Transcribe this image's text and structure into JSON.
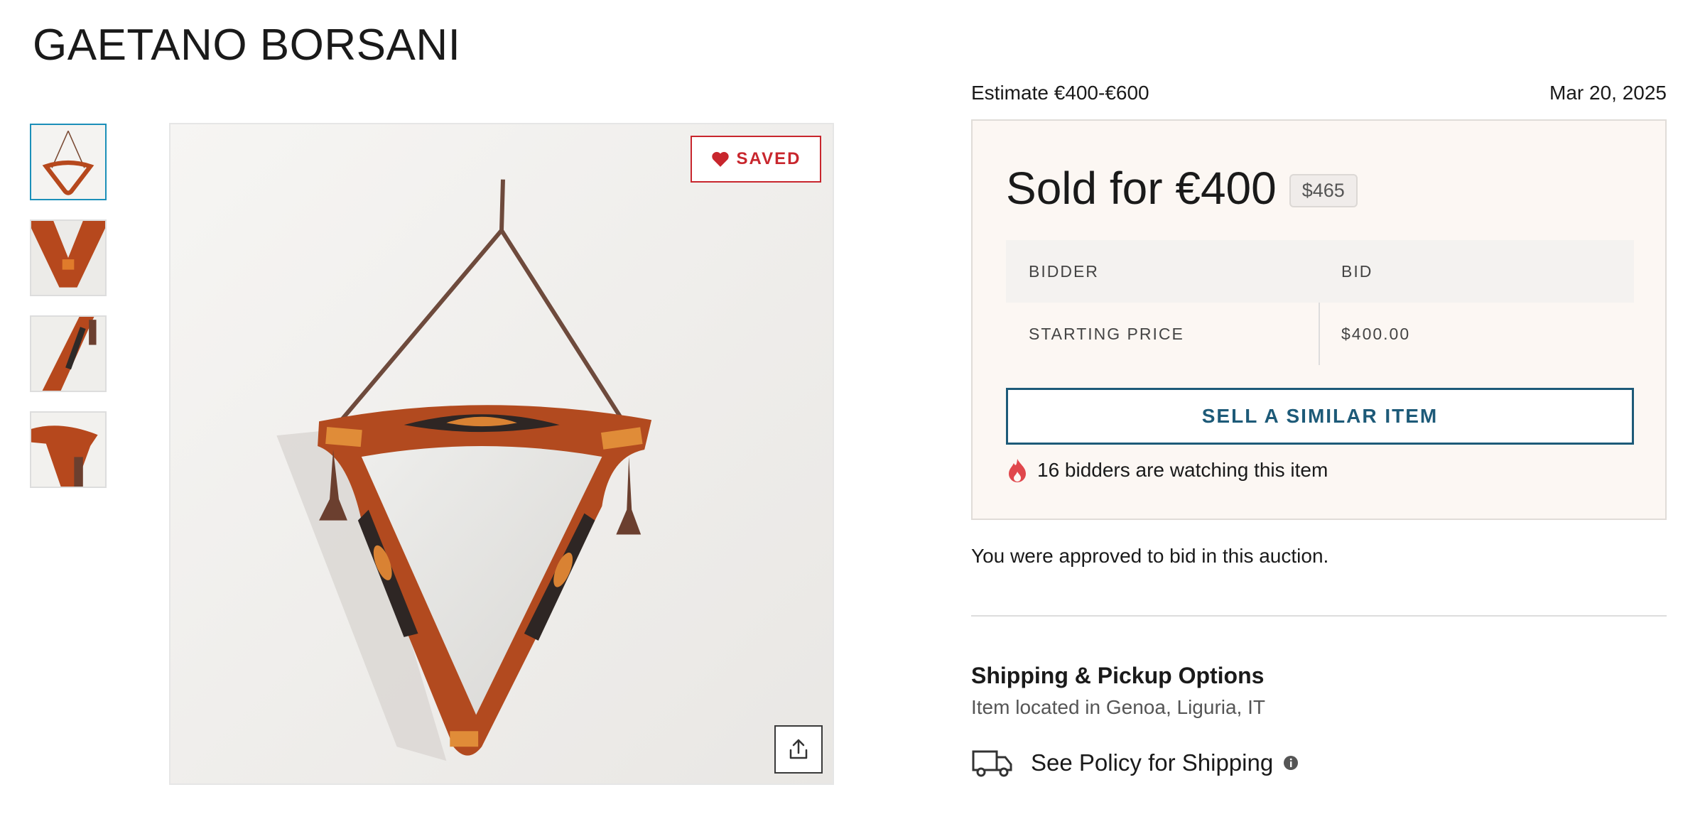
{
  "header": {
    "title": "GAETANO BORSANI"
  },
  "gallery": {
    "thumbnails": [
      "thumb-1",
      "thumb-2",
      "thumb-3",
      "thumb-4"
    ],
    "saved_label": "SAVED"
  },
  "auction": {
    "estimate": "Estimate €400-€600",
    "date": "Mar 20, 2025",
    "sold_label": "Sold for €400",
    "usd_value": "$465",
    "table": {
      "headers": [
        "BIDDER",
        "BID"
      ],
      "rows": [
        {
          "bidder": "STARTING PRICE",
          "bid": "$400.00"
        }
      ]
    },
    "sell_button": "SELL A SIMILAR ITEM",
    "watching": "16 bidders are watching this item",
    "approved": "You were approved to bid in this auction."
  },
  "shipping": {
    "title": "Shipping & Pickup Options",
    "location": "Item located in Genoa, Liguria, IT",
    "policy": "See Policy for Shipping"
  },
  "colors": {
    "accent": "#1d5a78",
    "saved": "#c8262d",
    "panel_bg": "#fcf7f3",
    "thumb_active": "#1b8fb9"
  },
  "icons": [
    "heart-icon",
    "share-icon",
    "flame-icon",
    "truck-icon",
    "info-icon"
  ]
}
